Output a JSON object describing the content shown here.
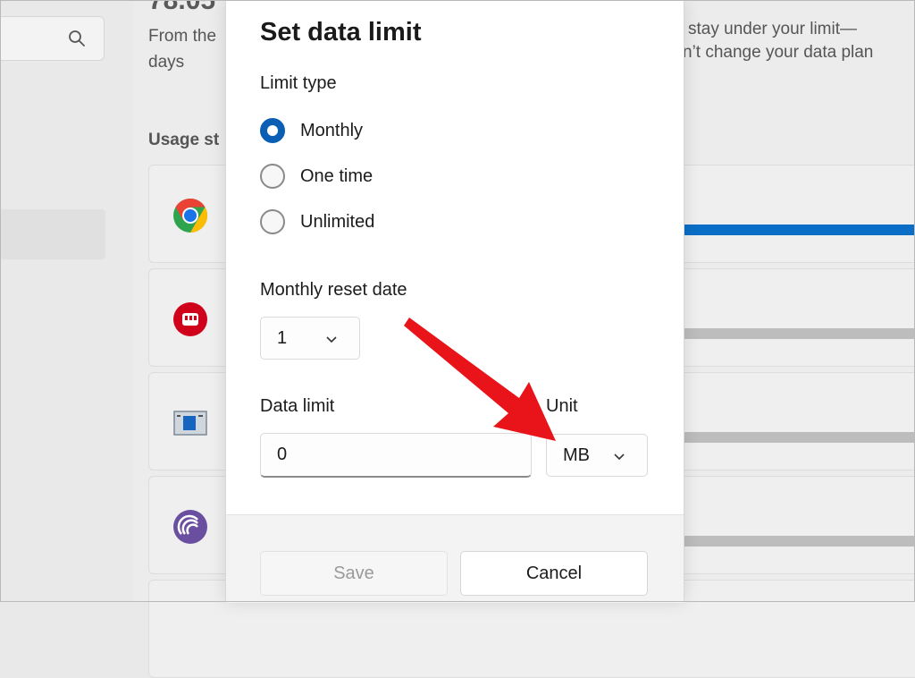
{
  "background": {
    "headline": "78.05",
    "line1_left": "From the",
    "line2_left": "days",
    "line1_right": "stay under your limit—",
    "line2_right": "n’t change your data plan",
    "section_label": "Usage st",
    "apps": [
      {
        "icon": "chrome-icon"
      },
      {
        "icon": "red-fist-app-icon"
      },
      {
        "icon": "window-app-icon"
      },
      {
        "icon": "purple-app-icon"
      }
    ]
  },
  "dialog": {
    "title": "Set data limit",
    "limit_type_label": "Limit type",
    "limit_options": [
      {
        "label": "Monthly",
        "checked": true
      },
      {
        "label": "One time",
        "checked": false
      },
      {
        "label": "Unlimited",
        "checked": false
      }
    ],
    "reset_date_label": "Monthly reset date",
    "reset_date_value": "1",
    "data_limit_label": "Data limit",
    "data_limit_value": "0",
    "unit_label": "Unit",
    "unit_value": "MB",
    "save_label": "Save",
    "cancel_label": "Cancel"
  },
  "colors": {
    "accent": "#0a5fb5",
    "annotation_arrow": "#e8141a",
    "usage_bar": "#0a6ec6"
  }
}
